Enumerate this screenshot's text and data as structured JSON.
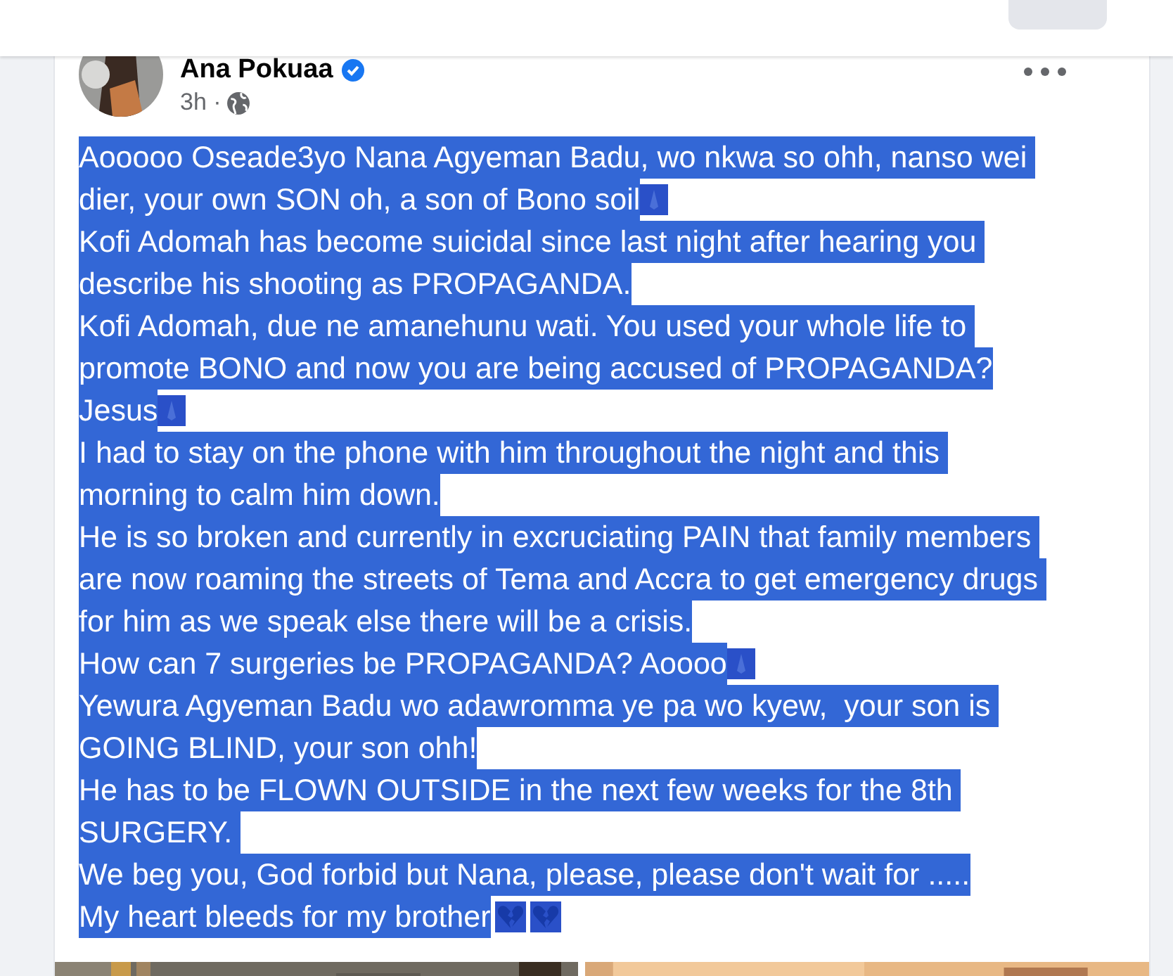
{
  "post": {
    "author": "Ana Pokuaa",
    "verified": true,
    "time": "3h ·",
    "text_selected": true,
    "paragraphs": [
      {
        "lines": [
          "Aooooo Oseade3yo Nana Agyeman Badu, wo nkwa so ohh, nanso wei ",
          "dier, your own SON oh, a son of Bono soil"
        ],
        "emoji": [
          {
            "kind": "pray"
          }
        ]
      },
      {
        "lines": [
          "Kofi Adomah has become suicidal since last night after hearing you ",
          "describe his shooting as PROPAGANDA."
        ]
      },
      {
        "lines": [
          "Kofi Adomah, due ne amanehunu wati. You used your whole life to ",
          "promote BONO and now you are being accused of PROPAGANDA?"
        ]
      },
      {
        "lines": [
          "Jesus"
        ],
        "emoji": [
          {
            "kind": "pray"
          }
        ]
      },
      {
        "lines": [
          "I had to stay on the phone with him throughout the night and this ",
          "morning to calm him down."
        ]
      },
      {
        "lines": [
          "He is so broken and currently in excruciating PAIN that family members ",
          "are now roaming the streets of Tema and Accra to get emergency drugs ",
          "for him as we speak else there will be a crisis."
        ]
      },
      {
        "lines": [
          "How can 7 surgeries be PROPAGANDA? Aoooo"
        ],
        "emoji": [
          {
            "kind": "pray"
          }
        ]
      },
      {
        "lines": [
          "Yewura Agyeman Badu wo adawromma ye pa wo kyew,  your son is ",
          "GOING BLIND, your son ohh!"
        ]
      },
      {
        "lines": [
          "He has to be FLOWN OUTSIDE in the next few weeks for the 8th ",
          "SURGERY. "
        ]
      },
      {
        "lines": [
          "We beg you, God forbid but Nana, please, please don't wait for ....."
        ]
      },
      {
        "lines": [
          "My heart bleeds for my brother"
        ],
        "emoji": [
          {
            "kind": "broken-heart"
          },
          {
            "kind": "broken-heart"
          }
        ]
      }
    ]
  }
}
